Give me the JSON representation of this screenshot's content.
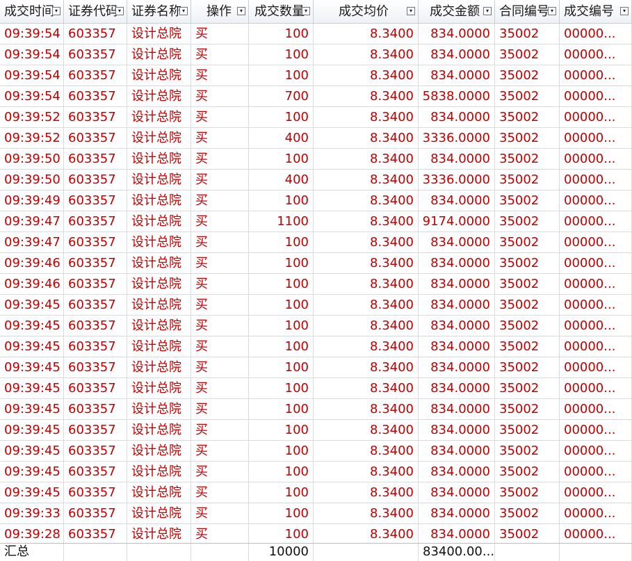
{
  "columns": [
    {
      "label": "成交时间",
      "align": "l"
    },
    {
      "label": "证券代码",
      "align": "l"
    },
    {
      "label": "证券名称",
      "align": "l"
    },
    {
      "label": "操作",
      "align": "l"
    },
    {
      "label": "成交数量",
      "align": "r"
    },
    {
      "label": "成交均价",
      "align": "r"
    },
    {
      "label": "成交金额",
      "align": "r"
    },
    {
      "label": "合同编号",
      "align": "l"
    },
    {
      "label": "成交编号",
      "align": "l"
    }
  ],
  "rows": [
    [
      "09:39:54",
      "603357",
      "设计总院",
      "买",
      "100",
      "8.3400",
      "834.0000",
      "35002",
      "00000..."
    ],
    [
      "09:39:54",
      "603357",
      "设计总院",
      "买",
      "100",
      "8.3400",
      "834.0000",
      "35002",
      "00000..."
    ],
    [
      "09:39:54",
      "603357",
      "设计总院",
      "买",
      "100",
      "8.3400",
      "834.0000",
      "35002",
      "00000..."
    ],
    [
      "09:39:54",
      "603357",
      "设计总院",
      "买",
      "700",
      "8.3400",
      "5838.0000",
      "35002",
      "00000..."
    ],
    [
      "09:39:52",
      "603357",
      "设计总院",
      "买",
      "100",
      "8.3400",
      "834.0000",
      "35002",
      "00000..."
    ],
    [
      "09:39:52",
      "603357",
      "设计总院",
      "买",
      "400",
      "8.3400",
      "3336.0000",
      "35002",
      "00000..."
    ],
    [
      "09:39:50",
      "603357",
      "设计总院",
      "买",
      "100",
      "8.3400",
      "834.0000",
      "35002",
      "00000..."
    ],
    [
      "09:39:50",
      "603357",
      "设计总院",
      "买",
      "400",
      "8.3400",
      "3336.0000",
      "35002",
      "00000..."
    ],
    [
      "09:39:49",
      "603357",
      "设计总院",
      "买",
      "100",
      "8.3400",
      "834.0000",
      "35002",
      "00000..."
    ],
    [
      "09:39:47",
      "603357",
      "设计总院",
      "买",
      "1100",
      "8.3400",
      "9174.0000",
      "35002",
      "00000..."
    ],
    [
      "09:39:47",
      "603357",
      "设计总院",
      "买",
      "100",
      "8.3400",
      "834.0000",
      "35002",
      "00000..."
    ],
    [
      "09:39:46",
      "603357",
      "设计总院",
      "买",
      "100",
      "8.3400",
      "834.0000",
      "35002",
      "00000..."
    ],
    [
      "09:39:46",
      "603357",
      "设计总院",
      "买",
      "100",
      "8.3400",
      "834.0000",
      "35002",
      "00000..."
    ],
    [
      "09:39:45",
      "603357",
      "设计总院",
      "买",
      "100",
      "8.3400",
      "834.0000",
      "35002",
      "00000..."
    ],
    [
      "09:39:45",
      "603357",
      "设计总院",
      "买",
      "100",
      "8.3400",
      "834.0000",
      "35002",
      "00000..."
    ],
    [
      "09:39:45",
      "603357",
      "设计总院",
      "买",
      "100",
      "8.3400",
      "834.0000",
      "35002",
      "00000..."
    ],
    [
      "09:39:45",
      "603357",
      "设计总院",
      "买",
      "100",
      "8.3400",
      "834.0000",
      "35002",
      "00000..."
    ],
    [
      "09:39:45",
      "603357",
      "设计总院",
      "买",
      "100",
      "8.3400",
      "834.0000",
      "35002",
      "00000..."
    ],
    [
      "09:39:45",
      "603357",
      "设计总院",
      "买",
      "100",
      "8.3400",
      "834.0000",
      "35002",
      "00000..."
    ],
    [
      "09:39:45",
      "603357",
      "设计总院",
      "买",
      "100",
      "8.3400",
      "834.0000",
      "35002",
      "00000..."
    ],
    [
      "09:39:45",
      "603357",
      "设计总院",
      "买",
      "100",
      "8.3400",
      "834.0000",
      "35002",
      "00000..."
    ],
    [
      "09:39:45",
      "603357",
      "设计总院",
      "买",
      "100",
      "8.3400",
      "834.0000",
      "35002",
      "00000..."
    ],
    [
      "09:39:45",
      "603357",
      "设计总院",
      "买",
      "100",
      "8.3400",
      "834.0000",
      "35002",
      "00000..."
    ],
    [
      "09:39:33",
      "603357",
      "设计总院",
      "买",
      "100",
      "8.3400",
      "834.0000",
      "35002",
      "00000..."
    ],
    [
      "09:39:28",
      "603357",
      "设计总院",
      "买",
      "100",
      "8.3400",
      "834.0000",
      "35002",
      "00000..."
    ]
  ],
  "footer": {
    "label": "汇总",
    "total_quantity": "10000",
    "total_amount": "83400.00..."
  },
  "colors": {
    "row_text": "#c00000",
    "header_text": "#1a1a1a",
    "grid_line": "#d8dbe0"
  },
  "icons": {
    "header_dropdown": "dropdown-arrow-icon"
  }
}
